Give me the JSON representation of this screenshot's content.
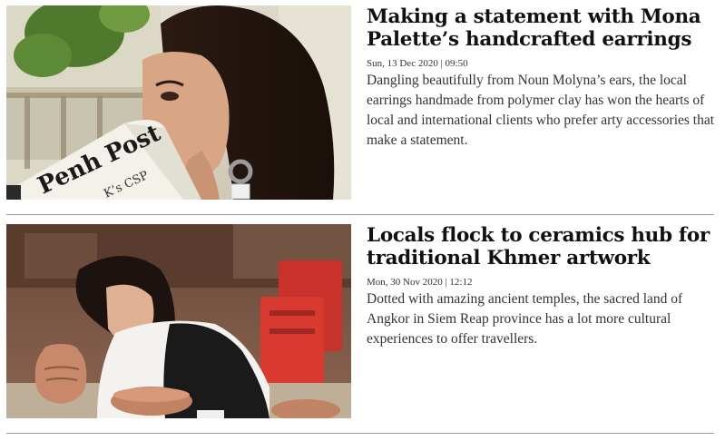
{
  "articles": [
    {
      "headline": "Making a statement with Mona Palette’s handcrafted earrings",
      "date": "Sun, 13 Dec 2020 | 09:50",
      "summary": "Dangling beautifully from Noun Molyna’s ears, the local earrings handmade from polymer clay has won the hearts of local and international clients who prefer arty accessories that make a statement.",
      "image": {
        "newspaper_text_1": "Penh Post",
        "newspaper_text_2": "K’s CSP"
      }
    },
    {
      "headline": "Locals flock to ceramics hub for traditional Khmer artwork",
      "date": "Mon, 30 Nov 2020 | 12:12",
      "summary": "Dotted with amazing ancient temples, the sacred land of Angkor in Siem Reap province has a lot more cultural experiences to offer travellers."
    }
  ]
}
